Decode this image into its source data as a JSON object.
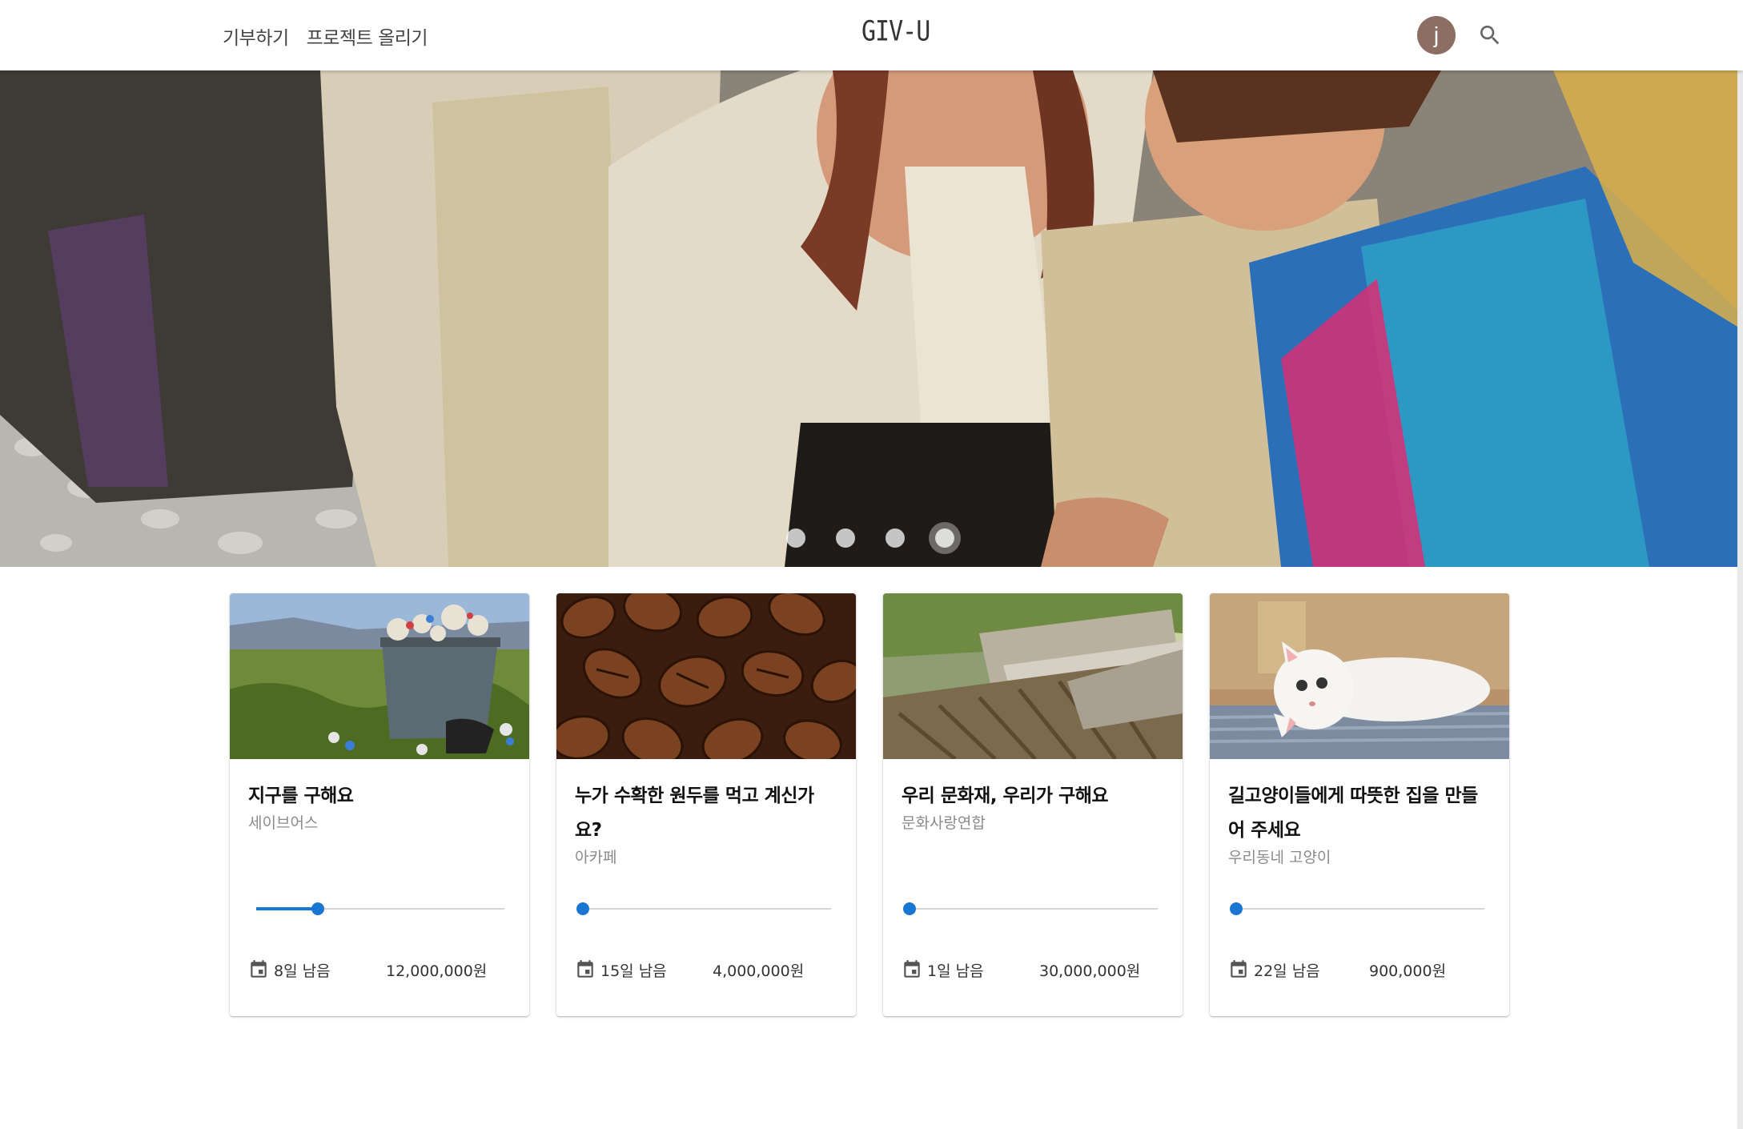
{
  "header": {
    "nav": [
      "기부하기",
      "프로젝트 올리기"
    ],
    "logo": "GIV-U",
    "avatar_initial": "j"
  },
  "hero": {
    "slides_count": 4,
    "active_slide": 4
  },
  "cards": [
    {
      "title": "지구를 구해요",
      "org": "세이브어스",
      "progress": 0.25,
      "days_left": "8일 남음",
      "amount": "12,000,000원",
      "image": "trash-dumpster"
    },
    {
      "title": "누가 수확한 원두를 먹고 계신가요?",
      "org": "아카페",
      "progress": 0,
      "days_left": "15일 남음",
      "amount": "4,000,000원",
      "image": "coffee-beans"
    },
    {
      "title": "우리 문화재, 우리가 구해요",
      "org": "문화사랑연합",
      "progress": 0,
      "days_left": "1일 남음",
      "amount": "30,000,000원",
      "image": "traditional-roof"
    },
    {
      "title": "길고양이들에게 따뜻한 집을 만들어 주세요",
      "org": "우리동네 고양이",
      "progress": 0,
      "days_left": "22일 남음",
      "amount": "900,000원",
      "image": "white-kitten"
    }
  ],
  "colors": {
    "accent": "#1976d2",
    "avatar": "#8d6e63"
  }
}
